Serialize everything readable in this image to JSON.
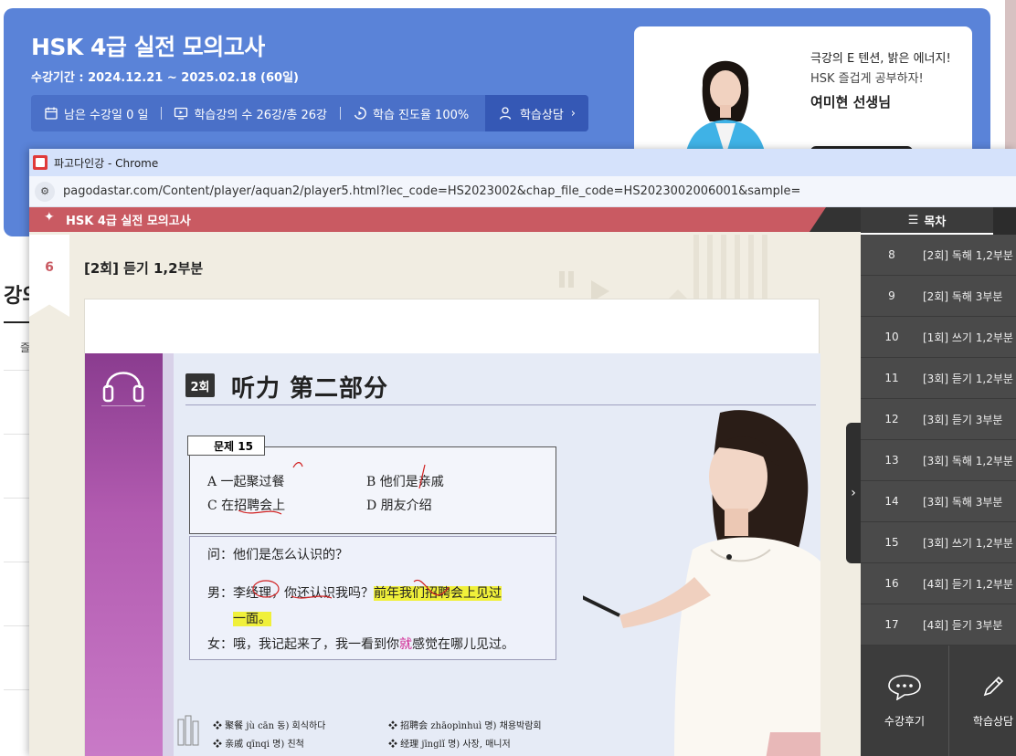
{
  "page": {
    "course_title": "HSK 4급 실전 모의고사",
    "course_period": "수강기간 : 2024.12.21 ~ 2025.02.18 (60일)",
    "stats": {
      "remaining_days": "남은 수강일 0 일",
      "lectures": "학습강의 수 26강/총 26강",
      "progress": "학습 진도율 100%",
      "consult": "학습상담"
    },
    "teacher": {
      "slogan1": "극강의 E 텐션, 밝은 에너지!",
      "slogan2": "HSK 즐겁게 공부하자!",
      "name": "여미현 선생님"
    },
    "left_peek": {
      "heading": "강의",
      "sub": "즐"
    }
  },
  "popup": {
    "window_title": "파고다인강 - Chrome",
    "url": "pagodastar.com/Content/player/aquan2/player5.html?lec_code=HS2023002&chap_file_code=HS2023002006001&sample=",
    "player_title": "HSK 4급 실전 모의고사",
    "lesson_number": "6",
    "lesson_title": "[2회] 듣기 1,2부분"
  },
  "slide": {
    "badge": "2회",
    "title": "听力 第二部分",
    "problem_label": "문제 15",
    "options": [
      "A 一起聚过餐",
      "B 他们是亲戚",
      "C 在招聘会上",
      "D 朋友介绍"
    ],
    "question": "问：他们是怎么认识的？",
    "line_man_a": "男：李经理，你还认识我吗？",
    "line_man_b": "前年我们招聘会上见过",
    "line_man_c": "一面。",
    "line_woman_a": "女：哦，我记起来了，我一看到你",
    "line_woman_b": "就",
    "line_woman_c": "感觉在哪儿见过。",
    "vocab": [
      "❖ 聚餐   jù cān   동) 회식하다",
      "❖ 亲戚   qīnqi   명) 친척",
      "❖ 招聘会   zhāopìnhuì   명) 채용박람회",
      "❖ 经理   jīnglǐ   명) 사장, 매니저"
    ]
  },
  "toc": {
    "header": "목차",
    "items": [
      {
        "num": "8",
        "label": "[2회] 독해 1,2부분"
      },
      {
        "num": "9",
        "label": "[2회] 독해 3부분"
      },
      {
        "num": "10",
        "label": "[1회] 쓰기 1,2부분"
      },
      {
        "num": "11",
        "label": "[3회] 듣기 1,2부분"
      },
      {
        "num": "12",
        "label": "[3회] 듣기 3부분"
      },
      {
        "num": "13",
        "label": "[3회] 독해 1,2부분"
      },
      {
        "num": "14",
        "label": "[3회] 독해 3부분"
      },
      {
        "num": "15",
        "label": "[3회] 쓰기 1,2부분"
      },
      {
        "num": "16",
        "label": "[4회] 듣기 1,2부분"
      },
      {
        "num": "17",
        "label": "[4회] 듣기 3부분"
      }
    ],
    "review_label": "수강후기",
    "consult_label": "학습상담"
  },
  "colors": {
    "header_blue": "#5a83d8",
    "player_red": "#c95a62",
    "sidebar_gray": "#4a4a4a",
    "highlight_yellow": "#f0f03a"
  }
}
